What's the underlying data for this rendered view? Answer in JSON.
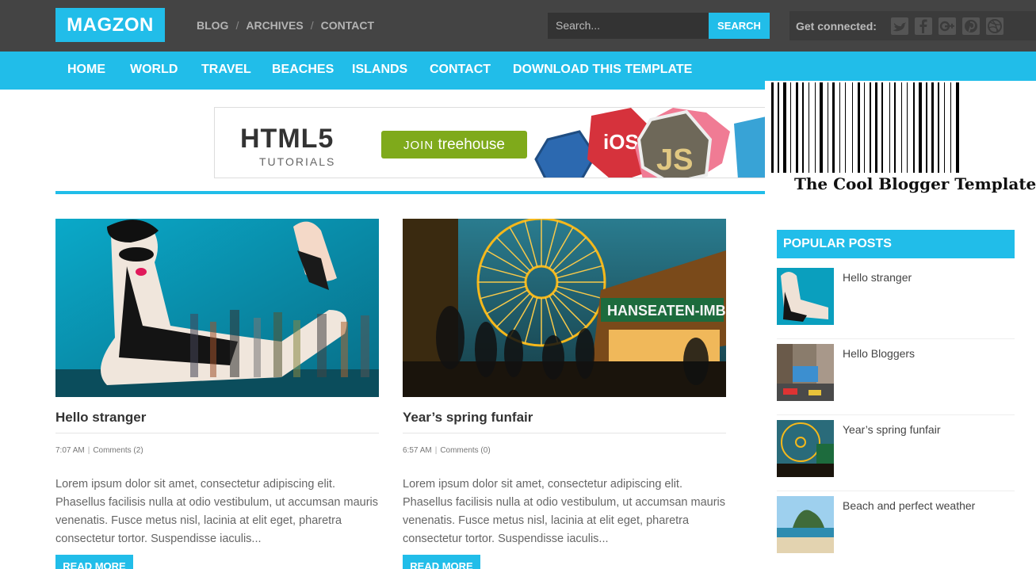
{
  "header": {
    "logo": "MAGZON",
    "topnav": [
      "BLOG",
      "ARCHIVES",
      "CONTACT"
    ],
    "separator": "/",
    "search_placeholder": "Search...",
    "search_button": "SEARCH",
    "connect_label": "Get connected:",
    "social_icons": [
      "twitter-icon",
      "facebook-icon",
      "google-plus-icon",
      "pinterest-icon",
      "dribbble-icon"
    ]
  },
  "mainnav": [
    "HOME",
    "WORLD",
    "TRAVEL",
    "BEACHES",
    "ISLANDS",
    "CONTACT",
    "DOWNLOAD THIS TEMPLATE"
  ],
  "banner": {
    "headline": "HTML5",
    "sub": "TUTORIALS",
    "cta_prefix": "JOIN",
    "cta_brand": "treehouse",
    "badges": [
      "iOS",
      "JS"
    ]
  },
  "watermark": "The Cool Blogger Templates",
  "posts": [
    {
      "title": "Hello stranger",
      "time": "7:07 AM",
      "comments": "Comments (2)",
      "excerpt": "Lorem ipsum dolor sit amet, consectetur adipiscing elit. Phasellus facilisis nulla at odio vestibulum, ut accumsan mauris venenatis. Fusce metus nisl, lacinia at elit eget, pharetra consectetur tortor. Suspendisse iaculis...",
      "read_more": "READ MORE"
    },
    {
      "title": "Year’s spring funfair",
      "time": "6:57 AM",
      "comments": "Comments (0)",
      "excerpt": "Lorem ipsum dolor sit amet, consectetur adipiscing elit. Phasellus facilisis nulla at odio vestibulum, ut accumsan mauris venenatis. Fusce metus nisl, lacinia at elit eget, pharetra consectetur tortor. Suspendisse iaculis...",
      "read_more": "READ MORE"
    }
  ],
  "sidebar": {
    "popular_title": "POPULAR POSTS",
    "popular_posts": [
      "Hello stranger",
      "Hello Bloggers",
      "Year’s spring funfair",
      "Beach and perfect weather"
    ]
  },
  "colors": {
    "accent": "#21bde9",
    "topbar": "#444444",
    "cta_green": "#7faa1b"
  }
}
